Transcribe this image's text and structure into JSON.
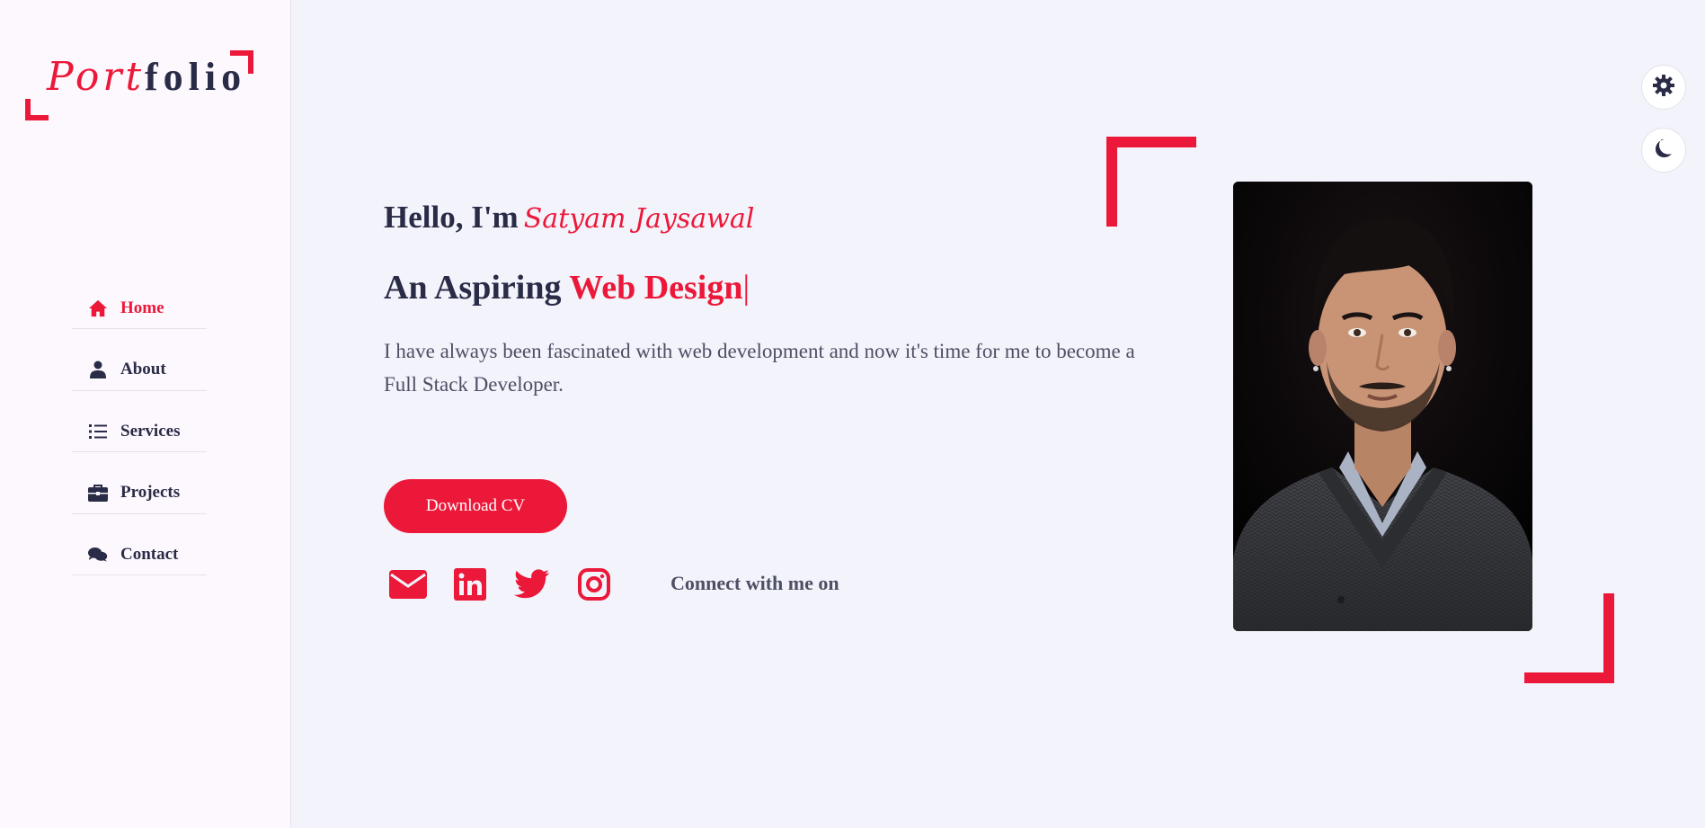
{
  "colors": {
    "accent": "#ec1839",
    "text": "#2a2c47",
    "muted": "#4d4f63",
    "background": "#f2f3fb",
    "sidebar": "#fdf8fd"
  },
  "logo": {
    "script": "Port",
    "rest": "folio"
  },
  "nav": {
    "items": [
      {
        "label": "Home",
        "icon": "home-icon",
        "active": true
      },
      {
        "label": "About",
        "icon": "user-icon",
        "active": false
      },
      {
        "label": "Services",
        "icon": "list-icon",
        "active": false
      },
      {
        "label": "Projects",
        "icon": "briefcase-icon",
        "active": false
      },
      {
        "label": "Contact",
        "icon": "comments-icon",
        "active": false
      }
    ]
  },
  "hero": {
    "greeting": "Hello, I'm",
    "name": "Satyam Jaysawal",
    "aspiring_prefix": "An Aspiring",
    "role": "Web Design",
    "cursor": "|",
    "intro": "I have always been fascinated with web development and now it's time for me to become a Full Stack Developer.",
    "cta_label": "Download CV",
    "connect_label": "Connect with me on"
  },
  "social": [
    {
      "icon": "envelope-icon"
    },
    {
      "icon": "linkedin-icon"
    },
    {
      "icon": "twitter-icon"
    },
    {
      "icon": "instagram-icon"
    }
  ],
  "controls": [
    {
      "icon": "gear-icon"
    },
    {
      "icon": "moon-icon"
    }
  ]
}
